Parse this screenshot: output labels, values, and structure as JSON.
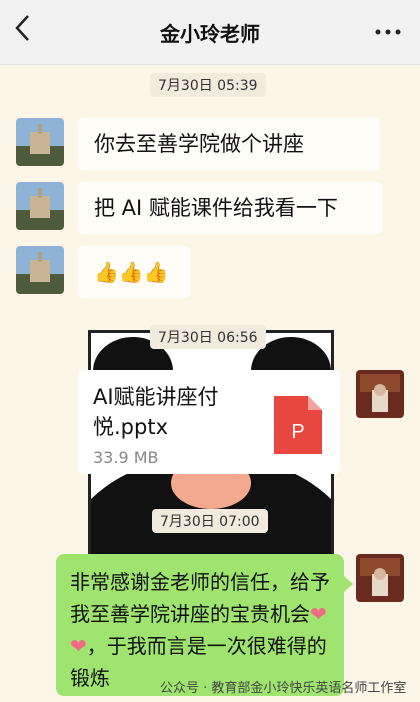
{
  "header": {
    "back_icon": "chevron-left-icon",
    "title": "金小玲老师",
    "more_icon": "more-dots-icon"
  },
  "timestamps": [
    "7月30日 05:39",
    "7月30日 06:56",
    "7月30日 07:00"
  ],
  "messages": [
    {
      "text": "你去至善学院做个讲座"
    },
    {
      "text": "把 AI 赋能课件给我看一下"
    },
    {
      "text": "👍👍👍"
    }
  ],
  "file": {
    "name": "AI赋能讲座付悦.pptx",
    "size": "33.9 MB",
    "icon_letter": "P",
    "icon_color": "#e8473f"
  },
  "reply": {
    "part1": "非常感谢金老师的信任，给予我至善学院讲座的宝贵机会",
    "hearts": "❤❤",
    "part2": "，于我而言是一次很难得的锻炼"
  },
  "watermark": "公众号 · 教育部金小玲快乐英语名师工作室"
}
